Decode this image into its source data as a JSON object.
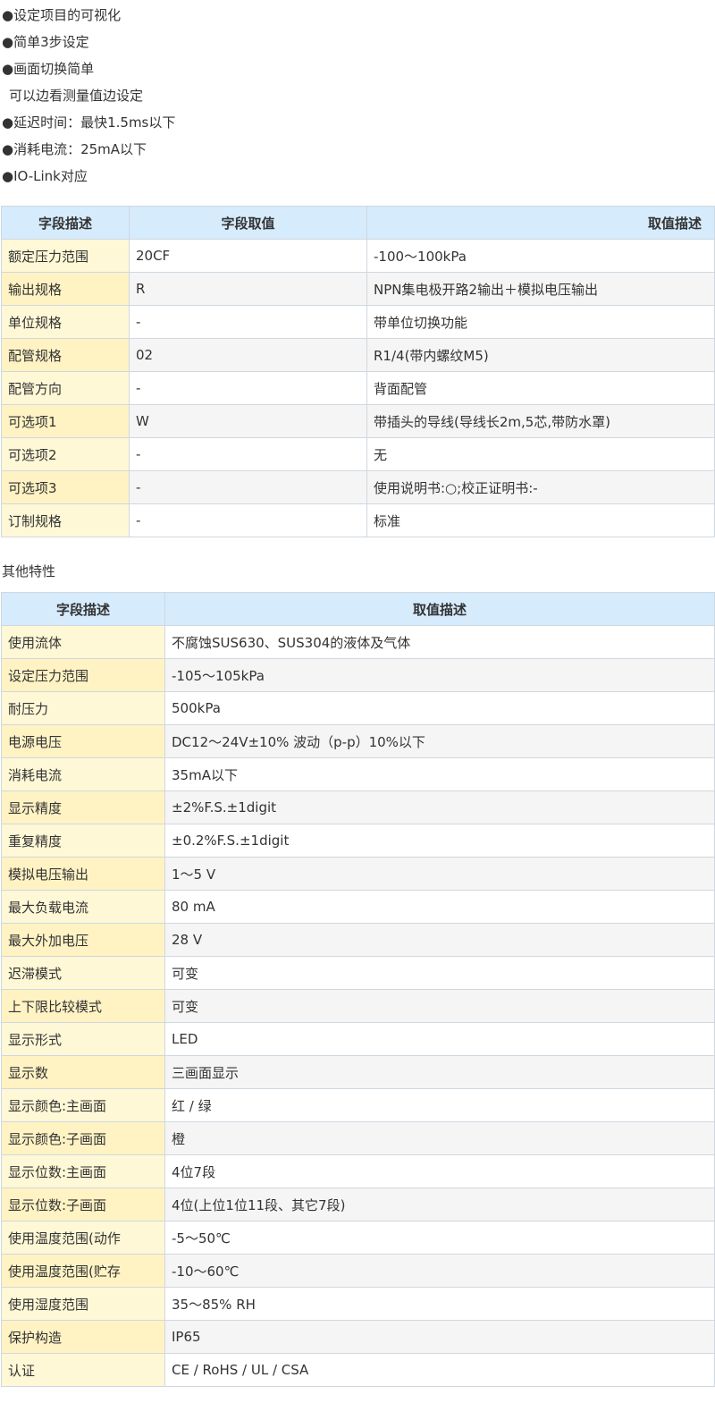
{
  "features": [
    "●设定项目的可视化",
    "●简单3步设定",
    "●画面切换简单",
    "可以边看测量值边设定",
    "●延迟时间：最快1.5ms以下",
    "●消耗电流：25mA以下",
    "●IO-Link对应"
  ],
  "model_table": {
    "headers": [
      "字段描述",
      "字段取值",
      "取值描述"
    ],
    "rows": [
      [
        "额定压力范围",
        "20CF",
        "-100～100kPa"
      ],
      [
        "输出规格",
        "R",
        "NPN集电极开路2输出＋模拟电压输出"
      ],
      [
        "单位规格",
        "-",
        "带单位切换功能"
      ],
      [
        "配管规格",
        "02",
        "R1/4(带内螺纹M5)"
      ],
      [
        "配管方向",
        "-",
        "背面配管"
      ],
      [
        "可选项1",
        "W",
        "带插头的导线(导线长2m,5芯,带防水罩)"
      ],
      [
        "可选项2",
        "-",
        "无"
      ],
      [
        "可选项3",
        "-",
        "使用说明书:○;校正证明书:-"
      ],
      [
        "订制规格",
        "-",
        "标准"
      ]
    ]
  },
  "other_title": "其他特性",
  "spec_table": {
    "headers": [
      "字段描述",
      "取值描述"
    ],
    "rows": [
      [
        "使用流体",
        "不腐蚀SUS630、SUS304的液体及气体"
      ],
      [
        "设定压力范围",
        "-105～105kPa"
      ],
      [
        "耐压力",
        "500kPa"
      ],
      [
        "电源电压",
        "DC12～24V±10% 波动（p-p）10%以下"
      ],
      [
        "消耗电流",
        "35mA以下"
      ],
      [
        "显示精度",
        "±2%F.S.±1digit"
      ],
      [
        "重复精度",
        "±0.2%F.S.±1digit"
      ],
      [
        "模拟电压输出",
        "1～5 V"
      ],
      [
        "最大负载电流",
        "80 mA"
      ],
      [
        "最大外加电压",
        "28 V"
      ],
      [
        "迟滞模式",
        "可变"
      ],
      [
        "上下限比较模式",
        "可变"
      ],
      [
        "显示形式",
        "LED"
      ],
      [
        "显示数",
        "三画面显示"
      ],
      [
        "显示颜色:主画面",
        "红 / 绿"
      ],
      [
        "显示颜色:子画面",
        "橙"
      ],
      [
        "显示位数:主画面",
        "4位7段"
      ],
      [
        "显示位数:子画面",
        "4位(上位1位11段、其它7段)"
      ],
      [
        "使用温度范围(动作",
        "-5～50℃"
      ],
      [
        "使用温度范围(贮存",
        "-10～60℃"
      ],
      [
        "使用湿度范围",
        "35～85% RH"
      ],
      [
        "保护构造",
        "IP65"
      ],
      [
        "认证",
        "CE / RoHS / UL / CSA"
      ]
    ]
  }
}
